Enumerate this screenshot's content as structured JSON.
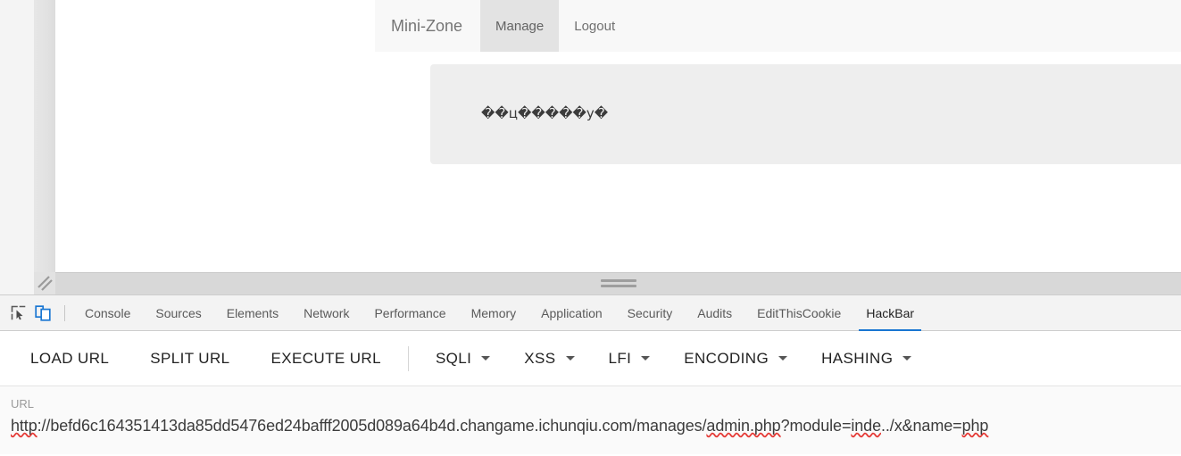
{
  "emulated_page": {
    "navbar": {
      "items": [
        {
          "label": "Mini-Zone",
          "active": false,
          "style": "brand"
        },
        {
          "label": "Manage",
          "active": true,
          "style": "active"
        },
        {
          "label": "Logout",
          "active": false,
          "style": "plain"
        }
      ]
    },
    "content_panel": {
      "output_text": "��ц�����у�"
    }
  },
  "devtools": {
    "toolbar_icons": [
      {
        "name": "inspect-element-icon",
        "active": false
      },
      {
        "name": "device-toolbar-icon",
        "active": true
      }
    ],
    "tabs": [
      {
        "label": "Console",
        "active": false
      },
      {
        "label": "Sources",
        "active": false
      },
      {
        "label": "Elements",
        "active": false
      },
      {
        "label": "Network",
        "active": false
      },
      {
        "label": "Performance",
        "active": false
      },
      {
        "label": "Memory",
        "active": false
      },
      {
        "label": "Application",
        "active": false
      },
      {
        "label": "Security",
        "active": false
      },
      {
        "label": "Audits",
        "active": false
      },
      {
        "label": "EditThisCookie",
        "active": false
      },
      {
        "label": "HackBar",
        "active": true
      }
    ],
    "active_tab_accent": "#1976d2"
  },
  "hackbar": {
    "actions": [
      {
        "label": "LOAD URL",
        "has_dropdown": false
      },
      {
        "label": "SPLIT URL",
        "has_dropdown": false
      },
      {
        "label": "EXECUTE URL",
        "has_dropdown": false
      }
    ],
    "menus": [
      {
        "label": "SQLI",
        "has_dropdown": true
      },
      {
        "label": "XSS",
        "has_dropdown": true
      },
      {
        "label": "LFI",
        "has_dropdown": true
      },
      {
        "label": "ENCODING",
        "has_dropdown": true
      },
      {
        "label": "HASHING",
        "has_dropdown": true
      }
    ],
    "url_field": {
      "label": "URL",
      "value": "http://befd6c164351413da85dd5476ed24bafff2005d089a64b4d.changame.ichunqiu.com/manages/admin.php?module=inde../x&name=php",
      "placeholder": "URL",
      "segments": [
        {
          "text": "http",
          "misspelled": true
        },
        {
          "text": "://befd6c164351413da85dd5476ed24bafff2005d089a64b4d.changame.ichunqiu.com/manages/",
          "misspelled": false
        },
        {
          "text": "admin.php",
          "misspelled": true
        },
        {
          "text": "?module=",
          "misspelled": false
        },
        {
          "text": "inde",
          "misspelled": true
        },
        {
          "text": "../x&name=",
          "misspelled": false
        },
        {
          "text": "php",
          "misspelled": true
        }
      ]
    }
  }
}
